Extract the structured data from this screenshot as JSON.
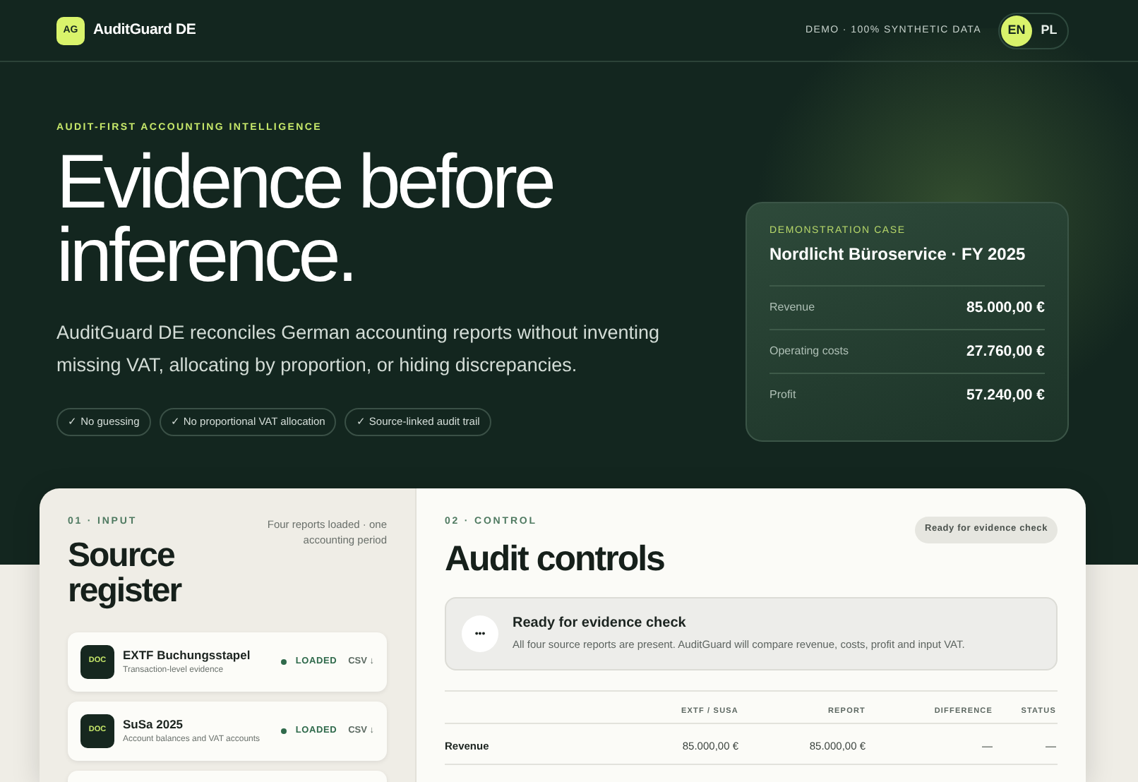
{
  "header": {
    "logo": "AG",
    "brand": "AuditGuard DE",
    "demo_note": "DEMO · 100% SYNTHETIC DATA",
    "languages": [
      {
        "label": "EN",
        "selected": true
      },
      {
        "label": "PL",
        "selected": false
      }
    ]
  },
  "hero": {
    "eyebrow": "AUDIT-FIRST ACCOUNTING INTELLIGENCE",
    "headline": "Evidence before inference.",
    "lead": "AuditGuard DE reconciles German accounting reports without inventing missing VAT, allocating by proportion, or hiding discrepancies.",
    "pills": [
      "✓ No guessing",
      "✓ No proportional VAT allocation",
      "✓ Source-linked audit trail"
    ]
  },
  "case_card": {
    "eyebrow": "DEMONSTRATION CASE",
    "title": "Nordlicht Büroservice · FY 2025",
    "rows": [
      {
        "label": "Revenue",
        "value": "85.000,00 €"
      },
      {
        "label": "Operating costs",
        "value": "27.760,00 €"
      },
      {
        "label": "Profit",
        "value": "57.240,00 €"
      }
    ]
  },
  "input_panel": {
    "eyebrow": "01 · INPUT",
    "title": "Source register",
    "note": "Four reports loaded · one accounting period",
    "sources": [
      {
        "icon_label": "DOC",
        "name": "EXTF Buchungsstapel",
        "description": "Transaction-level evidence",
        "status": "LOADED",
        "format": "CSV ↓"
      },
      {
        "icon_label": "DOC",
        "name": "SuSa 2025",
        "description": "Account balances and VAT accounts",
        "status": "LOADED",
        "format": "CSV ↓"
      }
    ]
  },
  "control_panel": {
    "eyebrow": "02 · CONTROL",
    "title": "Audit controls",
    "badge": "Ready for evidence check",
    "notice": {
      "icon": "•••",
      "title": "Ready for evidence check",
      "text": "All four source reports are present. AuditGuard will compare revenue, costs, profit and input VAT."
    },
    "table": {
      "columns": [
        "",
        "EXTF / SUSA",
        "REPORT",
        "DIFFERENCE",
        "STATUS"
      ],
      "rows": [
        [
          "Revenue",
          "85.000,00 €",
          "85.000,00 €",
          "—",
          "—"
        ]
      ]
    }
  }
}
